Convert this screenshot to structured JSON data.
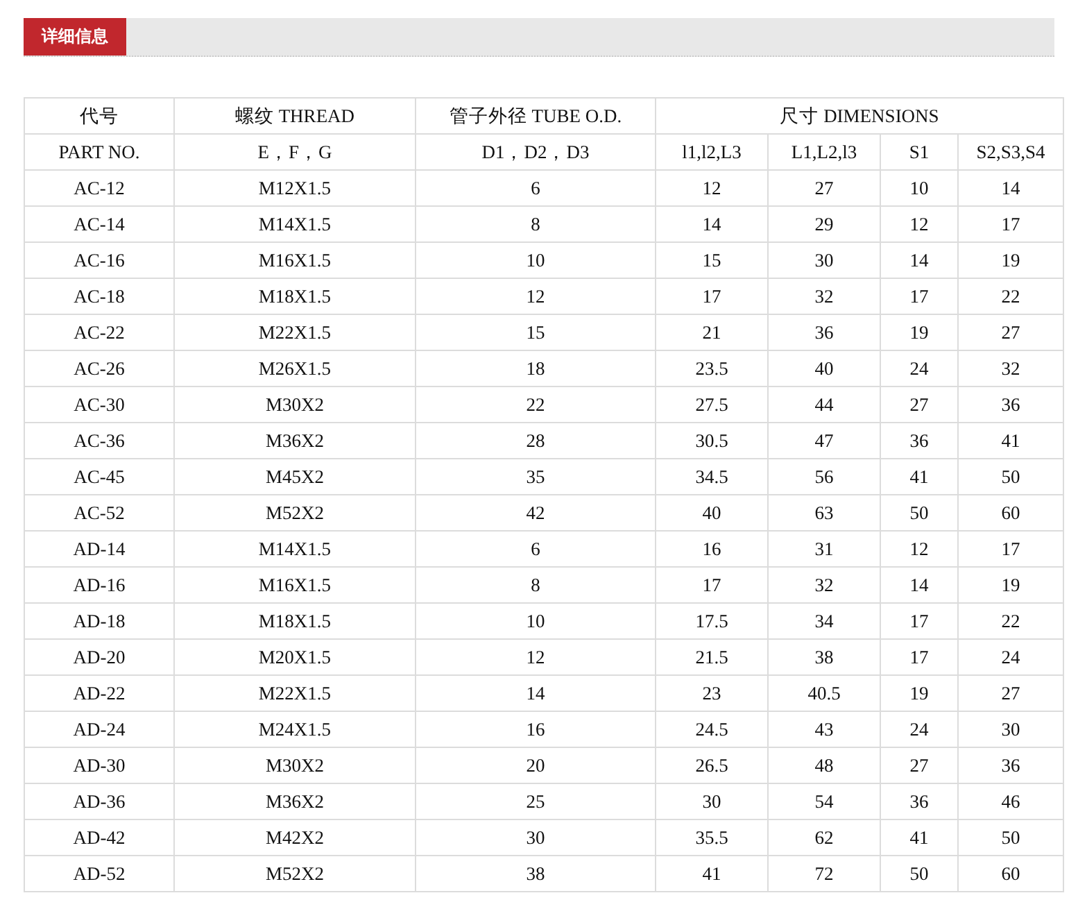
{
  "section_tab": {
    "label": "详细信息"
  },
  "table": {
    "header_top": [
      "代号",
      "螺纹 THREAD",
      "管子外径 TUBE O.D.",
      "尺寸 DIMENSIONS"
    ],
    "header_sub": [
      "PART NO.",
      "E，F，G",
      "D1，D2，D3",
      "l1,l2,L3",
      "L1,L2,l3",
      "S1",
      "S2,S3,S4"
    ],
    "rows": [
      [
        "AC-12",
        "M12X1.5",
        "6",
        "12",
        "27",
        "10",
        "14"
      ],
      [
        "AC-14",
        "M14X1.5",
        "8",
        "14",
        "29",
        "12",
        "17"
      ],
      [
        "AC-16",
        "M16X1.5",
        "10",
        "15",
        "30",
        "14",
        "19"
      ],
      [
        "AC-18",
        "M18X1.5",
        "12",
        "17",
        "32",
        "17",
        "22"
      ],
      [
        "AC-22",
        "M22X1.5",
        "15",
        "21",
        "36",
        "19",
        "27"
      ],
      [
        "AC-26",
        "M26X1.5",
        "18",
        "23.5",
        "40",
        "24",
        "32"
      ],
      [
        "AC-30",
        "M30X2",
        "22",
        "27.5",
        "44",
        "27",
        "36"
      ],
      [
        "AC-36",
        "M36X2",
        "28",
        "30.5",
        "47",
        "36",
        "41"
      ],
      [
        "AC-45",
        "M45X2",
        "35",
        "34.5",
        "56",
        "41",
        "50"
      ],
      [
        "AC-52",
        "M52X2",
        "42",
        "40",
        "63",
        "50",
        "60"
      ],
      [
        "AD-14",
        "M14X1.5",
        "6",
        "16",
        "31",
        "12",
        "17"
      ],
      [
        "AD-16",
        "M16X1.5",
        "8",
        "17",
        "32",
        "14",
        "19"
      ],
      [
        "AD-18",
        "M18X1.5",
        "10",
        "17.5",
        "34",
        "17",
        "22"
      ],
      [
        "AD-20",
        "M20X1.5",
        "12",
        "21.5",
        "38",
        "17",
        "24"
      ],
      [
        "AD-22",
        "M22X1.5",
        "14",
        "23",
        "40.5",
        "19",
        "27"
      ],
      [
        "AD-24",
        "M24X1.5",
        "16",
        "24.5",
        "43",
        "24",
        "30"
      ],
      [
        "AD-30",
        "M30X2",
        "20",
        "26.5",
        "48",
        "27",
        "36"
      ],
      [
        "AD-36",
        "M36X2",
        "25",
        "30",
        "54",
        "36",
        "46"
      ],
      [
        "AD-42",
        "M42X2",
        "30",
        "35.5",
        "62",
        "41",
        "50"
      ],
      [
        "AD-52",
        "M52X2",
        "38",
        "41",
        "72",
        "50",
        "60"
      ]
    ]
  }
}
